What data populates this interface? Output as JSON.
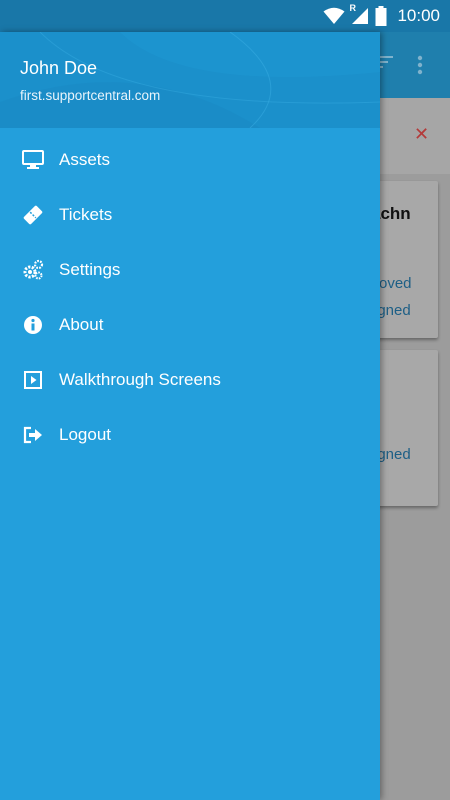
{
  "status_bar": {
    "time": "10:00",
    "network_badge": "R",
    "icons": [
      "wifi-icon",
      "signal-icon",
      "battery-icon"
    ]
  },
  "drawer": {
    "user_name": "John Doe",
    "user_url": "first.supportcentral.com",
    "items": [
      {
        "label": "Assets",
        "icon": "monitor-icon"
      },
      {
        "label": "Tickets",
        "icon": "ticket-icon"
      },
      {
        "label": "Settings",
        "icon": "gears-icon"
      },
      {
        "label": "About",
        "icon": "info-icon"
      },
      {
        "label": "Walkthrough Screens",
        "icon": "play-icon"
      },
      {
        "label": "Logout",
        "icon": "logout-icon"
      }
    ]
  },
  "background": {
    "card1_title_fragment": "achn",
    "card1_status_1": "roved",
    "card1_status_2": "igned",
    "card2_status": "igned"
  },
  "colors": {
    "drawer": "#239fdc",
    "header": "#1b90cb",
    "status_bar": "#1977a8",
    "scrim": "#9c9c9c"
  }
}
